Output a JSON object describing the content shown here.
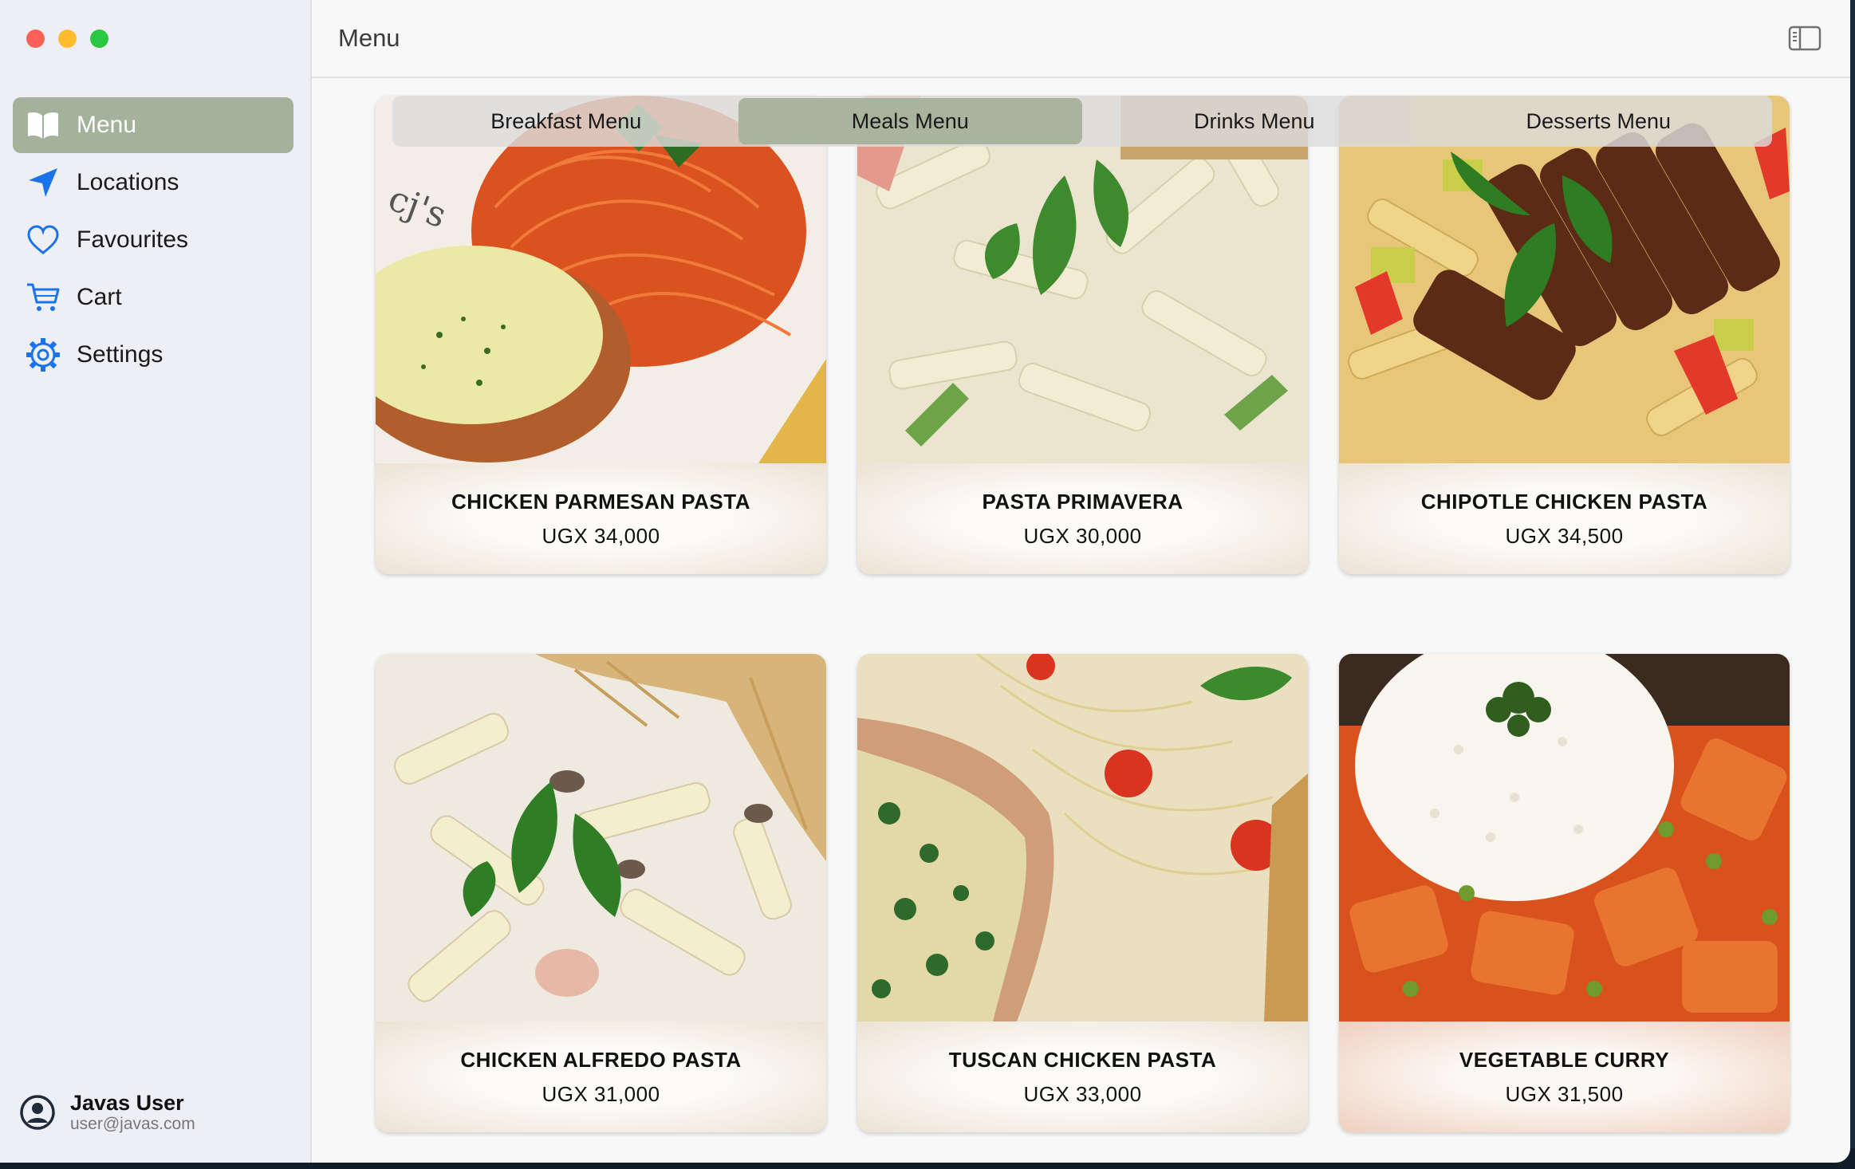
{
  "window": {
    "title": "Menu"
  },
  "sidebar": {
    "items": [
      {
        "label": "Menu",
        "icon": "book-icon",
        "active": true
      },
      {
        "label": "Locations",
        "icon": "location-arrow-icon",
        "active": false
      },
      {
        "label": "Favourites",
        "icon": "heart-icon",
        "active": false
      },
      {
        "label": "Cart",
        "icon": "cart-icon",
        "active": false
      },
      {
        "label": "Settings",
        "icon": "gear-icon",
        "active": false
      }
    ],
    "user": {
      "name": "Javas User",
      "email": "user@javas.com"
    }
  },
  "tabs": [
    {
      "label": "Breakfast Menu",
      "selected": false
    },
    {
      "label": "Meals Menu",
      "selected": true
    },
    {
      "label": "Drinks Menu",
      "selected": false
    },
    {
      "label": "Desserts Menu",
      "selected": false
    }
  ],
  "menu_items": [
    {
      "name": "CHICKEN PARMESAN PASTA",
      "price": "UGX 34,000"
    },
    {
      "name": "PASTA PRIMAVERA",
      "price": "UGX 30,000"
    },
    {
      "name": "CHIPOTLE CHICKEN PASTA",
      "price": "UGX 34,500"
    },
    {
      "name": "CHICKEN ALFREDO PASTA",
      "price": "UGX 31,000"
    },
    {
      "name": "TUSCAN CHICKEN PASTA",
      "price": "UGX 33,000"
    },
    {
      "name": "VEGETABLE CURRY",
      "price": "UGX 31,500"
    }
  ],
  "colors": {
    "accent": "#a5b29b",
    "icon_blue": "#1a73e8"
  }
}
